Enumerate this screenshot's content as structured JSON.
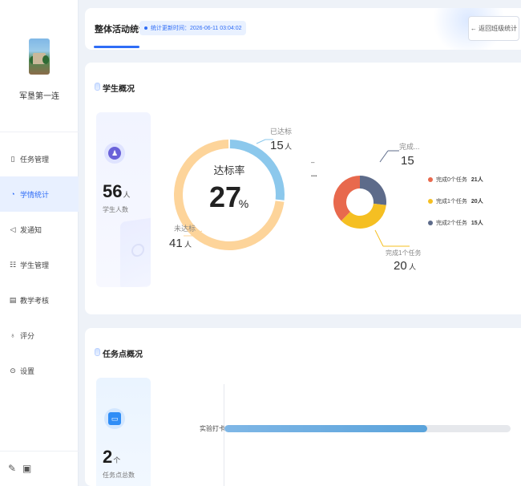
{
  "sidebar": {
    "profile_name": "军垦第一连",
    "items": [
      {
        "label": "任务管理",
        "icon": "task-icon"
      },
      {
        "label": "学情统计",
        "icon": "stats-icon",
        "active": true
      },
      {
        "label": "发通知",
        "icon": "notice-icon"
      },
      {
        "label": "学生管理",
        "icon": "student-icon"
      },
      {
        "label": "教学考核",
        "icon": "assessment-icon"
      },
      {
        "label": "评分",
        "icon": "rating-icon"
      },
      {
        "label": "设置",
        "icon": "settings-icon"
      }
    ]
  },
  "header": {
    "title": "整体活动统计",
    "update_time": "统计更新时间：2026-06-11 03:04:02",
    "back_label": "← 返回班级统计"
  },
  "students": {
    "title": "学生概况",
    "total": "56",
    "unit": "人",
    "label": "学生人数",
    "donut1": {
      "center_label": "达标率",
      "center_value": "27",
      "center_unit": "%",
      "reached_label": "已达标",
      "reached_value": "15",
      "not_reached_label": "未达标",
      "not_reached_value": "41",
      "unit": "人"
    },
    "donut2": {
      "left_dash": "–",
      "left_ellipsis": "...",
      "top_label": "完成...",
      "top_value": "15",
      "bottom_label": "完成1个任务",
      "bottom_value": "20",
      "unit": "人"
    },
    "legend": [
      {
        "label": "完成0个任务",
        "count": "21人",
        "color": "#e8694d"
      },
      {
        "label": "完成1个任务",
        "count": "20人",
        "color": "#f5bf22"
      },
      {
        "label": "完成2个任务",
        "count": "15人",
        "color": "#5d6b8a"
      }
    ]
  },
  "tasks": {
    "title": "任务点概况",
    "total": "2",
    "unit": "个",
    "label": "任务点总数",
    "bars": [
      {
        "label": "实验打卡",
        "progress": 0.71
      }
    ]
  },
  "chart_data": [
    {
      "type": "pie",
      "title": "达标率",
      "categories": [
        "已达标",
        "未达标"
      ],
      "values": [
        15,
        41
      ],
      "colors": [
        "#8cc8ec",
        "#fdd49a"
      ]
    },
    {
      "type": "pie",
      "categories": [
        "完成0个任务",
        "完成1个任务",
        "完成2个任务"
      ],
      "values": [
        21,
        20,
        15
      ],
      "colors": [
        "#e8694d",
        "#f5bf22",
        "#5d6b8a"
      ]
    }
  ]
}
